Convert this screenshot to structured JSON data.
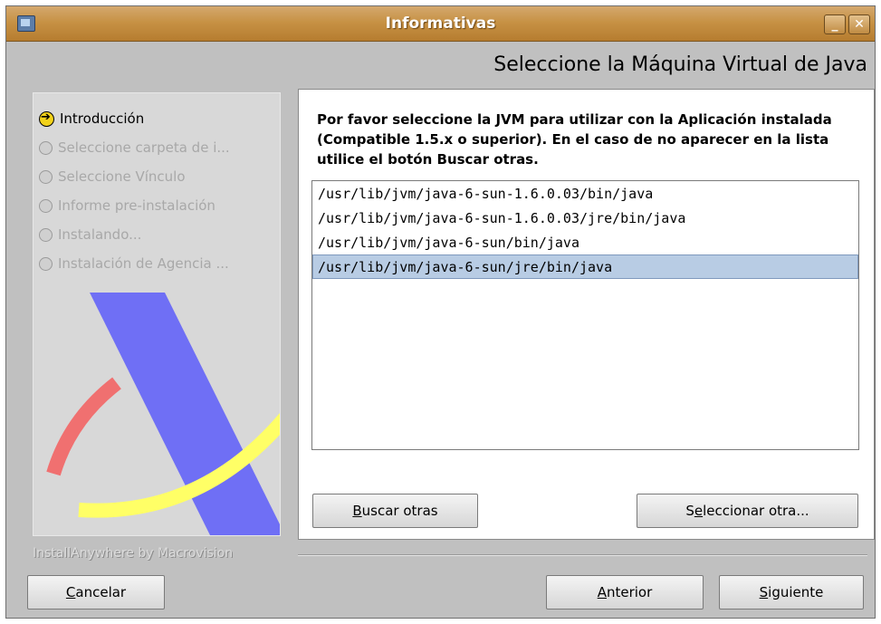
{
  "window": {
    "title": "Informativas",
    "minimize_glyph": "_",
    "close_glyph": "✕"
  },
  "heading": "Seleccione la Máquina Virtual de  Java",
  "steps": [
    {
      "label": "Introducción",
      "state": "active",
      "icon": "arrow-right-icon"
    },
    {
      "label": "Seleccione carpeta de i...",
      "state": "pending",
      "icon": "radio-icon"
    },
    {
      "label": "Seleccione  Vínculo",
      "state": "pending",
      "icon": "radio-icon"
    },
    {
      "label": "Informe pre-instalación",
      "state": "pending",
      "icon": "radio-icon"
    },
    {
      "label": "Instalando...",
      "state": "pending",
      "icon": "radio-icon"
    },
    {
      "label": "Instalación de Agencia ...",
      "state": "pending",
      "icon": "radio-icon"
    }
  ],
  "branding": "InstallAnywhere by Macrovision",
  "instructions": "Por favor seleccione la JVM para utilizar con la Aplicación instalada (Compatible 1.5.x o superior). En el caso de no aparecer en la lista utilice el botón Buscar otras.",
  "jvm_list": [
    {
      "path": "/usr/lib/jvm/java-6-sun-1.6.0.03/bin/java",
      "selected": false
    },
    {
      "path": "/usr/lib/jvm/java-6-sun-1.6.0.03/jre/bin/java",
      "selected": false
    },
    {
      "path": "/usr/lib/jvm/java-6-sun/bin/java",
      "selected": false
    },
    {
      "path": "/usr/lib/jvm/java-6-sun/jre/bin/java",
      "selected": true
    }
  ],
  "buttons": {
    "buscar": {
      "mnemonic": "B",
      "rest": "uscar otras"
    },
    "seleccionar": {
      "pre": "S",
      "mnemonic": "e",
      "rest": "leccionar otra..."
    },
    "cancelar": {
      "mnemonic": "C",
      "rest": "ancelar"
    },
    "anterior": {
      "mnemonic": "A",
      "rest": "nterior"
    },
    "siguiente": {
      "mnemonic": "S",
      "rest": "iguiente"
    }
  },
  "colors": {
    "titlebar": "#c79245",
    "selection": "#b8cce4",
    "logo_blue": "#6f6ff5",
    "logo_yellow": "#ffff66",
    "logo_red": "#f07070"
  }
}
